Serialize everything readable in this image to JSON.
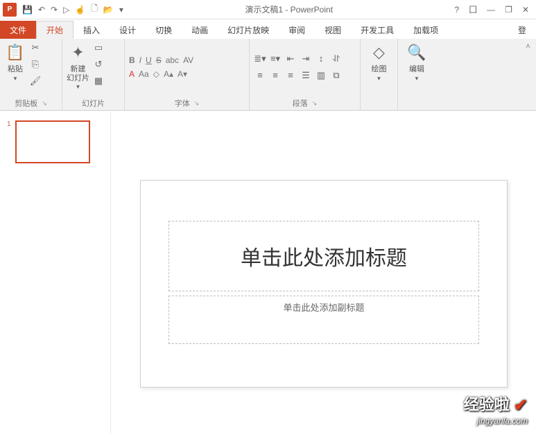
{
  "titlebar": {
    "doc_title": "演示文稿1 - PowerPoint",
    "qat": {
      "save": "💾",
      "undo": "↶",
      "redo": "↷",
      "start": "▷",
      "touch": "☝",
      "new": "🗋",
      "open": "📂",
      "more": "▾"
    },
    "help": "?",
    "ribbon_opts": "⼞",
    "min": "—",
    "restore": "❐",
    "close": "✕"
  },
  "tabs": {
    "file": "文件",
    "home": "开始",
    "insert": "插入",
    "design": "设计",
    "transitions": "切换",
    "animations": "动画",
    "slideshow": "幻灯片放映",
    "review": "审阅",
    "view": "视图",
    "developer": "开发工具",
    "addins": "加载项",
    "login": "登"
  },
  "groups": {
    "clipboard": {
      "label": "剪贴板",
      "paste": "粘贴",
      "cut": "✂",
      "copy": "⎘",
      "format_painter": "🖌"
    },
    "slides": {
      "label": "幻灯片",
      "new_slide": "新建\n幻灯片",
      "layout": "▭",
      "reset": "↺",
      "section": "▦"
    },
    "font": {
      "label": "字体",
      "bold": "B",
      "italic": "I",
      "underline": "U",
      "strike": "S",
      "shadow": "abc",
      "spacing": "AV",
      "fontA": "A",
      "case": "Aa",
      "clear": "◇",
      "grow": "A▴",
      "shrink": "A▾"
    },
    "paragraph": {
      "label": "段落"
    },
    "drawing": {
      "label": "绘图"
    },
    "editing": {
      "label": "编辑"
    }
  },
  "slide": {
    "title_ph": "单击此处添加标题",
    "subtitle_ph": "单击此处添加副标题",
    "thumb_num": "1"
  },
  "watermark": {
    "l1": "经验啦",
    "l2": "jingyanla.com"
  }
}
